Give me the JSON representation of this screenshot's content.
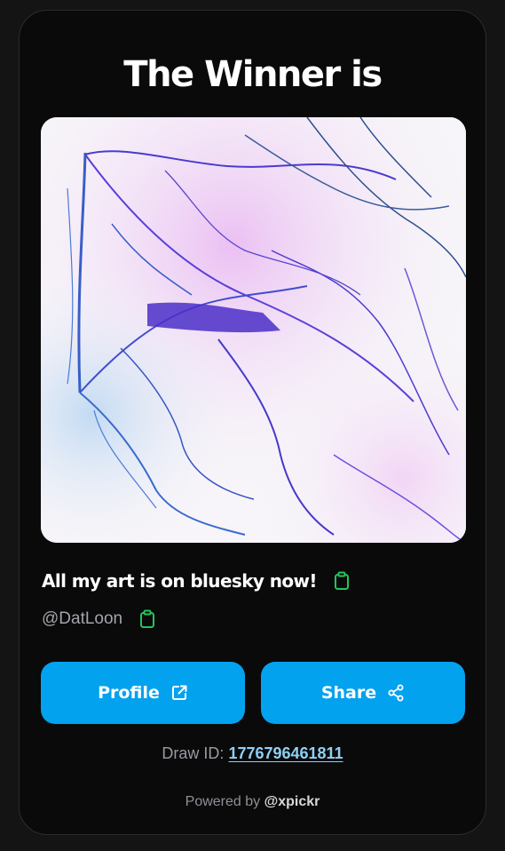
{
  "header": {
    "title": "The Winner is"
  },
  "winner": {
    "post_text": "All my art is on bluesky now!",
    "handle": "@DatLoon",
    "image_description": "purple-blue-pen-sketch"
  },
  "buttons": {
    "profile_label": "Profile",
    "share_label": "Share"
  },
  "draw": {
    "label": "Draw ID:",
    "id": "1776796461811"
  },
  "footer": {
    "powered_label": "Powered by",
    "brand": "@xpickr"
  },
  "icons": {
    "copy": "clipboard-icon",
    "external": "external-link-icon",
    "share": "share-nodes-icon"
  },
  "colors": {
    "accent": "#03a2ef",
    "copy_icon": "#22c55e",
    "link": "#8fd0f5",
    "card_background": "#0a0a0b"
  }
}
